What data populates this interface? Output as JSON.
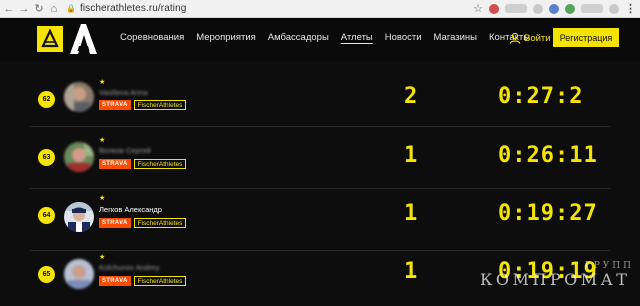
{
  "browser": {
    "url": "fischerathletes.ru/rating",
    "back_icon": "arrow-left",
    "forward_icon": "arrow-right",
    "reload_icon": "reload",
    "home_icon": "home",
    "bookmark_icon": "star",
    "menu_icon": "kebab"
  },
  "header": {
    "logo_icon": "fischer-logo",
    "brand_icon": "athletes-a-logo",
    "nav": [
      {
        "label": "Соревнования"
      },
      {
        "label": "Мероприятия"
      },
      {
        "label": "Амбассадоры"
      },
      {
        "label": "Атлеты",
        "active": true
      },
      {
        "label": "Новости"
      },
      {
        "label": "Магазины"
      },
      {
        "label": "Контакты"
      }
    ],
    "login_label": "Войти",
    "register_label": "Регистрация",
    "accent": "#f5e400"
  },
  "rows": [
    {
      "rank": "62",
      "name": "Vasilieva Anna",
      "name_blurred": true,
      "strava": "STRAVA",
      "badge": "FischerAthletes",
      "count": "2",
      "time": "0:27:2",
      "avatar_blurred": true
    },
    {
      "rank": "63",
      "name": "Волков Сергей",
      "name_blurred": true,
      "strava": "STRAVA",
      "badge": "FischerAthletes",
      "count": "1",
      "time": "0:26:11",
      "avatar_blurred": true
    },
    {
      "rank": "64",
      "name": "Легков Александр",
      "name_blurred": false,
      "strava": "STRAVA",
      "badge": "FischerAthletes",
      "count": "1",
      "time": "0:19:27",
      "avatar_blurred": false
    },
    {
      "rank": "65",
      "name": "Kolchunov Andrey",
      "name_blurred": true,
      "strava": "STRAVA",
      "badge": "FischerAthletes",
      "count": "1",
      "time": "0:19:19",
      "avatar_blurred": true
    }
  ],
  "watermark": {
    "sub": "ГРУПП",
    "main": "КОМПРОМАТ"
  }
}
